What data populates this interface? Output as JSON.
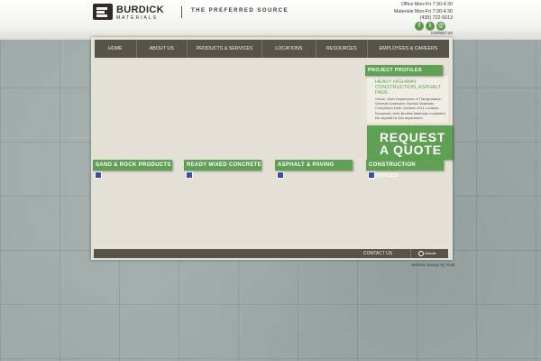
{
  "header": {
    "logo": {
      "name": "BURDICK",
      "sub": "MATERIALS"
    },
    "tagline": "THE PREFERRED SOURCE",
    "hours": {
      "office": "Office Mon-Fri 7:30-4:30",
      "materials": "Materials Mon-Fri 7:30-4:30",
      "phone": "(435) 722-5013"
    },
    "social": [
      {
        "icon": "facebook-icon",
        "glyph": "f"
      },
      {
        "icon": "twitter-icon",
        "glyph": "t"
      },
      {
        "icon": "email-icon",
        "glyph": "@"
      }
    ],
    "contact_link": "contact us"
  },
  "nav": {
    "items": [
      "HOME",
      "ABOUT US",
      "PRODUCTS & SERVICES",
      "LOCATIONS",
      "RESOURCES",
      "EMPLOYEES & CAREERS"
    ]
  },
  "project_profiles": {
    "heading": "PROJECT PROFILES",
    "title": "HEAVY HIGHWAY CONSTRUCTION, ASPHALT PAVE",
    "body": "Owner: Utah Department of Transportation General Contractor: Burdick Materials Completion Date: October 2011 Location: Roosevelt, Utah Burdick Materials completed the asphalt for this department"
  },
  "request_quote": {
    "line1": "REQUEST",
    "line2": "A QUOTE"
  },
  "slider": {
    "count": 4,
    "active": 0
  },
  "services": [
    {
      "label": "SAND & ROCK PRODUCTS"
    },
    {
      "label": "READY MIXED CONCRETE"
    },
    {
      "label": "ASPHALT & PAVING"
    },
    {
      "label": "CONSTRUCTION SERVICES"
    }
  ],
  "footer": {
    "contact": "CONTACT US",
    "badge": "Website",
    "credit": "Website Design by Fluid"
  },
  "colors": {
    "green": "#5fa055",
    "nav_brown": "#57524a",
    "panel_bg": "#e6e1d6"
  }
}
